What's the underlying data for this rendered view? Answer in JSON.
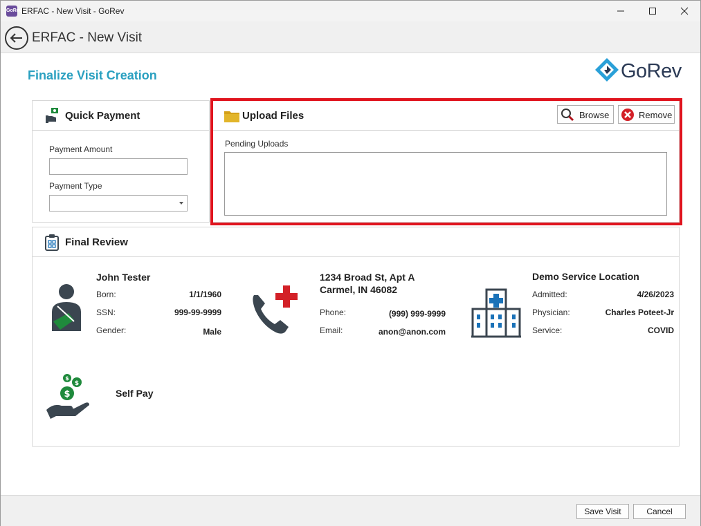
{
  "window": {
    "app_icon_text": "GoRev",
    "title": "ERFAC - New Visit - GoRev",
    "controls": {
      "minimize": "—",
      "maximize": "☐",
      "close": "✕"
    }
  },
  "header": {
    "title": "ERFAC - New Visit",
    "back_icon": "back-arrow-icon"
  },
  "page": {
    "heading": "Finalize Visit Creation",
    "logo_text": "GoRev"
  },
  "quick_payment": {
    "title": "Quick Payment",
    "icon": "payment-icon",
    "amount_label": "Payment Amount",
    "amount_value": "",
    "type_label": "Payment Type",
    "type_value": ""
  },
  "upload_files": {
    "title": "Upload Files",
    "icon": "folder-icon",
    "browse_label": "Browse",
    "remove_label": "Remove",
    "pending_label": "Pending Uploads",
    "highlight_color": "#e0141e"
  },
  "final_review": {
    "title": "Final Review",
    "icon": "clipboard-icon",
    "patient": {
      "name": "John Tester",
      "born_label": "Born:",
      "born_value": "1/1/1960",
      "ssn_label": "SSN:",
      "ssn_value": "999-99-9999",
      "gender_label": "Gender:",
      "gender_value": "Male"
    },
    "contact": {
      "address_line1": "1234 Broad St, Apt A",
      "address_line2": "Carmel, IN 46082",
      "phone_label": "Phone:",
      "phone_value": "(999) 999-9999",
      "email_label": "Email:",
      "email_value": "anon@anon.com"
    },
    "location": {
      "name": "Demo Service Location",
      "admitted_label": "Admitted:",
      "admitted_value": "4/26/2023",
      "physician_label": "Physician:",
      "physician_value": "Charles Poteet-Jr",
      "service_label": "Service:",
      "service_value": "COVID"
    },
    "payer": {
      "name": "Self Pay"
    }
  },
  "footer": {
    "save_label": "Save Visit",
    "cancel_label": "Cancel"
  },
  "colors": {
    "accent": "#2aa0c0",
    "highlight": "#e0141e",
    "icon_dark": "#3b4650",
    "icon_green": "#1f8a3c",
    "icon_red": "#d32027",
    "hospital_blue": "#1b72b8"
  }
}
